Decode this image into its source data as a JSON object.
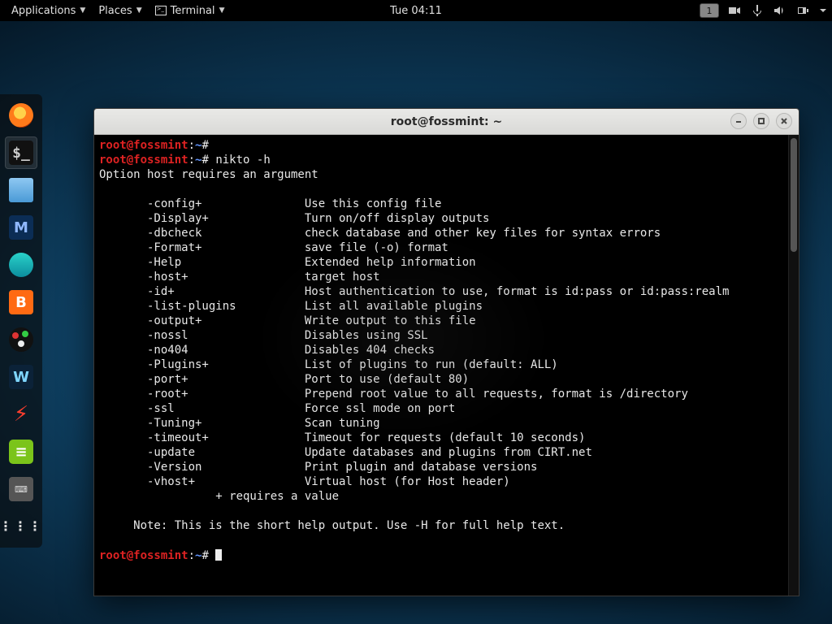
{
  "topbar": {
    "applications": "Applications",
    "places": "Places",
    "terminal": "Terminal",
    "clock": "Tue 04:11",
    "workspace": "1"
  },
  "dock": {
    "firefox": "Firefox",
    "terminal": "Terminal",
    "files": "Files",
    "metasploit": "Metasploit",
    "anime": "App",
    "burp": "Burp Suite",
    "obs": "OBS",
    "wireshark": "Wireshark",
    "ferret": "App",
    "editor": "Editor",
    "keyboard": "On-screen Keyboard",
    "showapps": "Show Applications"
  },
  "window": {
    "title": "root@fossmint: ~"
  },
  "prompt": {
    "userhost": "root@fossmint",
    "colon": ":",
    "cwd": "~",
    "hash": "#"
  },
  "lines": {
    "cmd1": "",
    "cmd2": "nikto -h",
    "err": "Option host requires an argument",
    "opts": [
      [
        "-config+",
        "Use this config file"
      ],
      [
        "-Display+",
        "Turn on/off display outputs"
      ],
      [
        "-dbcheck",
        "check database and other key files for syntax errors"
      ],
      [
        "-Format+",
        "save file (-o) format"
      ],
      [
        "-Help",
        "Extended help information"
      ],
      [
        "-host+",
        "target host"
      ],
      [
        "-id+",
        "Host authentication to use, format is id:pass or id:pass:realm"
      ],
      [
        "-list-plugins",
        "List all available plugins"
      ],
      [
        "-output+",
        "Write output to this file"
      ],
      [
        "-nossl",
        "Disables using SSL"
      ],
      [
        "-no404",
        "Disables 404 checks"
      ],
      [
        "-Plugins+",
        "List of plugins to run (default: ALL)"
      ],
      [
        "-port+",
        "Port to use (default 80)"
      ],
      [
        "-root+",
        "Prepend root value to all requests, format is /directory"
      ],
      [
        "-ssl",
        "Force ssl mode on port"
      ],
      [
        "-Tuning+",
        "Scan tuning"
      ],
      [
        "-timeout+",
        "Timeout for requests (default 10 seconds)"
      ],
      [
        "-update",
        "Update databases and plugins from CIRT.net"
      ],
      [
        "-Version",
        "Print plugin and database versions"
      ],
      [
        "-vhost+",
        "Virtual host (for Host header)"
      ]
    ],
    "reqnote": "               + requires a value",
    "note": "   Note: This is the short help output. Use -H for full help text."
  }
}
